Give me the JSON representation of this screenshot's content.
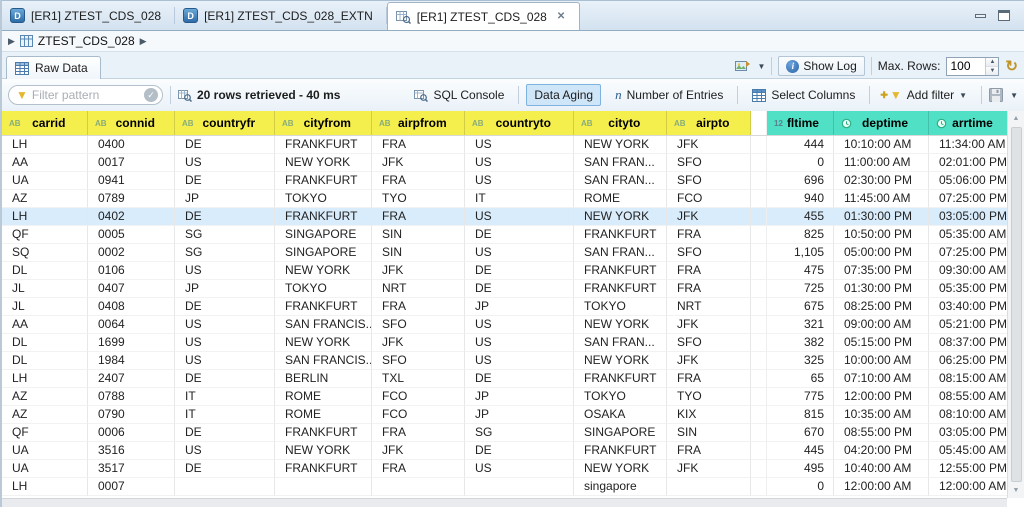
{
  "window": {
    "tabs": [
      {
        "label": "[ER1] ZTEST_CDS_028",
        "icon": "ddls",
        "icon_letter": "D",
        "active": false
      },
      {
        "label": "[ER1] ZTEST_CDS_028_EXTN",
        "icon": "ddls",
        "icon_letter": "D",
        "active": false
      },
      {
        "label": "[ER1] ZTEST_CDS_028",
        "icon": "data-preview",
        "active": true,
        "close_glyph": "✕"
      }
    ]
  },
  "breadcrumb": {
    "item": "ZTEST_CDS_028"
  },
  "view": {
    "tab_label": "Raw Data",
    "show_log": "Show Log",
    "max_rows_label": "Max. Rows:",
    "max_rows_value": "100"
  },
  "toolbar": {
    "filter_placeholder": "Filter pattern",
    "status": "20 rows retrieved - 40 ms",
    "sql_console": "SQL Console",
    "data_aging": "Data Aging",
    "number_of_entries": "Number of Entries",
    "select_columns": "Select Columns",
    "add_filter": "Add filter"
  },
  "table": {
    "widths": [
      86,
      87,
      100,
      97,
      93,
      109,
      93,
      84,
      16,
      67,
      95,
      80
    ],
    "columns": [
      {
        "key": "carrid",
        "label": "carrid",
        "type": "text",
        "group": "key"
      },
      {
        "key": "connid",
        "label": "connid",
        "type": "text",
        "group": "key"
      },
      {
        "key": "countryfr",
        "label": "countryfr",
        "type": "text",
        "group": "key"
      },
      {
        "key": "cityfrom",
        "label": "cityfrom",
        "type": "text",
        "group": "key"
      },
      {
        "key": "airpfrom",
        "label": "airpfrom",
        "type": "text",
        "group": "key"
      },
      {
        "key": "countryto",
        "label": "countryto",
        "type": "text",
        "group": "key"
      },
      {
        "key": "cityto",
        "label": "cityto",
        "type": "text",
        "group": "key"
      },
      {
        "key": "airpto",
        "label": "airpto",
        "type": "text",
        "group": "key"
      },
      {
        "key": "spacer",
        "label": "",
        "type": "spacer",
        "group": "spacer"
      },
      {
        "key": "fltime",
        "label": "fltime",
        "type": "number",
        "group": "time"
      },
      {
        "key": "deptime",
        "label": "deptime",
        "type": "time",
        "group": "time"
      },
      {
        "key": "arrtime",
        "label": "arrtime",
        "type": "time",
        "group": "time"
      }
    ],
    "selected_row_index": 4,
    "rows": [
      [
        "LH",
        "0400",
        "DE",
        "FRANKFURT",
        "FRA",
        "US",
        "NEW YORK",
        "JFK",
        "",
        "444",
        "10:10:00 AM",
        "11:34:00 AM"
      ],
      [
        "AA",
        "0017",
        "US",
        "NEW YORK",
        "JFK",
        "US",
        "SAN FRAN...",
        "SFO",
        "",
        "0",
        "11:00:00 AM",
        "02:01:00 PM"
      ],
      [
        "UA",
        "0941",
        "DE",
        "FRANKFURT",
        "FRA",
        "US",
        "SAN FRAN...",
        "SFO",
        "",
        "696",
        "02:30:00 PM",
        "05:06:00 PM"
      ],
      [
        "AZ",
        "0789",
        "JP",
        "TOKYO",
        "TYO",
        "IT",
        "ROME",
        "FCO",
        "",
        "940",
        "11:45:00 AM",
        "07:25:00 PM"
      ],
      [
        "LH",
        "0402",
        "DE",
        "FRANKFURT",
        "FRA",
        "US",
        "NEW YORK",
        "JFK",
        "",
        "455",
        "01:30:00 PM",
        "03:05:00 PM"
      ],
      [
        "QF",
        "0005",
        "SG",
        "SINGAPORE",
        "SIN",
        "DE",
        "FRANKFURT",
        "FRA",
        "",
        "825",
        "10:50:00 PM",
        "05:35:00 AM"
      ],
      [
        "SQ",
        "0002",
        "SG",
        "SINGAPORE",
        "SIN",
        "US",
        "SAN FRAN...",
        "SFO",
        "",
        "1,105",
        "05:00:00 PM",
        "07:25:00 PM"
      ],
      [
        "DL",
        "0106",
        "US",
        "NEW YORK",
        "JFK",
        "DE",
        "FRANKFURT",
        "FRA",
        "",
        "475",
        "07:35:00 PM",
        "09:30:00 AM"
      ],
      [
        "JL",
        "0407",
        "JP",
        "TOKYO",
        "NRT",
        "DE",
        "FRANKFURT",
        "FRA",
        "",
        "725",
        "01:30:00 PM",
        "05:35:00 PM"
      ],
      [
        "JL",
        "0408",
        "DE",
        "FRANKFURT",
        "FRA",
        "JP",
        "TOKYO",
        "NRT",
        "",
        "675",
        "08:25:00 PM",
        "03:40:00 PM"
      ],
      [
        "AA",
        "0064",
        "US",
        "SAN FRANCIS...",
        "SFO",
        "US",
        "NEW YORK",
        "JFK",
        "",
        "321",
        "09:00:00 AM",
        "05:21:00 PM"
      ],
      [
        "DL",
        "1699",
        "US",
        "NEW YORK",
        "JFK",
        "US",
        "SAN FRAN...",
        "SFO",
        "",
        "382",
        "05:15:00 PM",
        "08:37:00 PM"
      ],
      [
        "DL",
        "1984",
        "US",
        "SAN FRANCIS...",
        "SFO",
        "US",
        "NEW YORK",
        "JFK",
        "",
        "325",
        "10:00:00 AM",
        "06:25:00 PM"
      ],
      [
        "LH",
        "2407",
        "DE",
        "BERLIN",
        "TXL",
        "DE",
        "FRANKFURT",
        "FRA",
        "",
        "65",
        "07:10:00 AM",
        "08:15:00 AM"
      ],
      [
        "AZ",
        "0788",
        "IT",
        "ROME",
        "FCO",
        "JP",
        "TOKYO",
        "TYO",
        "",
        "775",
        "12:00:00 PM",
        "08:55:00 AM"
      ],
      [
        "AZ",
        "0790",
        "IT",
        "ROME",
        "FCO",
        "JP",
        "OSAKA",
        "KIX",
        "",
        "815",
        "10:35:00 AM",
        "08:10:00 AM"
      ],
      [
        "QF",
        "0006",
        "DE",
        "FRANKFURT",
        "FRA",
        "SG",
        "SINGAPORE",
        "SIN",
        "",
        "670",
        "08:55:00 PM",
        "03:05:00 PM"
      ],
      [
        "UA",
        "3516",
        "US",
        "NEW YORK",
        "JFK",
        "DE",
        "FRANKFURT",
        "FRA",
        "",
        "445",
        "04:20:00 PM",
        "05:45:00 AM"
      ],
      [
        "UA",
        "3517",
        "DE",
        "FRANKFURT",
        "FRA",
        "US",
        "NEW YORK",
        "JFK",
        "",
        "495",
        "10:40:00 AM",
        "12:55:00 PM"
      ],
      [
        "LH",
        "0007",
        "",
        "",
        "",
        "",
        "singapore",
        "",
        "",
        "0",
        "12:00:00 AM",
        "12:00:00 AM"
      ]
    ]
  },
  "colors": {
    "key_column_highlight": "#f5ef4e",
    "time_column_highlight": "#4fe0c5",
    "selected_row": "#d9ecfb",
    "active_tool": "#cfe5f8"
  }
}
